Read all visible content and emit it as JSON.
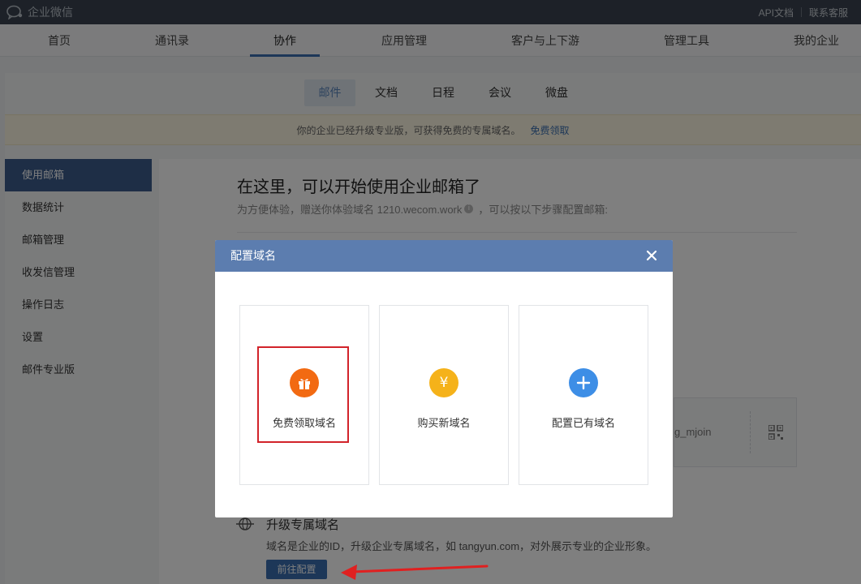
{
  "topbar": {
    "app_name": "企业微信",
    "links": [
      "API文档",
      "联系客服"
    ]
  },
  "main_nav": {
    "items": [
      "首页",
      "通讯录",
      "协作",
      "应用管理",
      "客户与上下游",
      "管理工具",
      "我的企业"
    ],
    "active": "协作"
  },
  "sub_tabs": {
    "items": [
      "邮件",
      "文档",
      "日程",
      "会议",
      "微盘"
    ],
    "active": "邮件"
  },
  "notice": {
    "text": "你的企业已经升级专业版，可获得免费的专属域名。",
    "link": "免费领取"
  },
  "sidebar": {
    "items": [
      "使用邮箱",
      "数据统计",
      "邮箱管理",
      "收发信管理",
      "操作日志",
      "设置",
      "邮件专业版"
    ],
    "active": "使用邮箱"
  },
  "hero": {
    "title": "在这里，可以开始使用企业邮箱了",
    "subtitle_prefix": "为方便体验，赠送你体验域名 1210.wecom.work",
    "subtitle_suffix": "，可以按以下步骤配置邮箱:"
  },
  "qr_panel": {
    "partial_text": "g_mjoin"
  },
  "upgrade": {
    "title": "升级专属域名",
    "description": "域名是企业的ID，升级企业专属域名，如 tangyun.com，对外展示专业的企业形象。",
    "button": "前往配置"
  },
  "modal": {
    "title": "配置域名",
    "options": [
      {
        "label": "免费领取域名",
        "icon": "gift-icon",
        "color": "#f26a12"
      },
      {
        "label": "购买新域名",
        "icon": "yen-icon",
        "color": "#f5b21a"
      },
      {
        "label": "配置已有域名",
        "icon": "plus-icon",
        "color": "#3d8ee6"
      }
    ]
  },
  "annotations": {
    "highlight_color": "#d2232a",
    "arrow_color": "#e02020"
  }
}
